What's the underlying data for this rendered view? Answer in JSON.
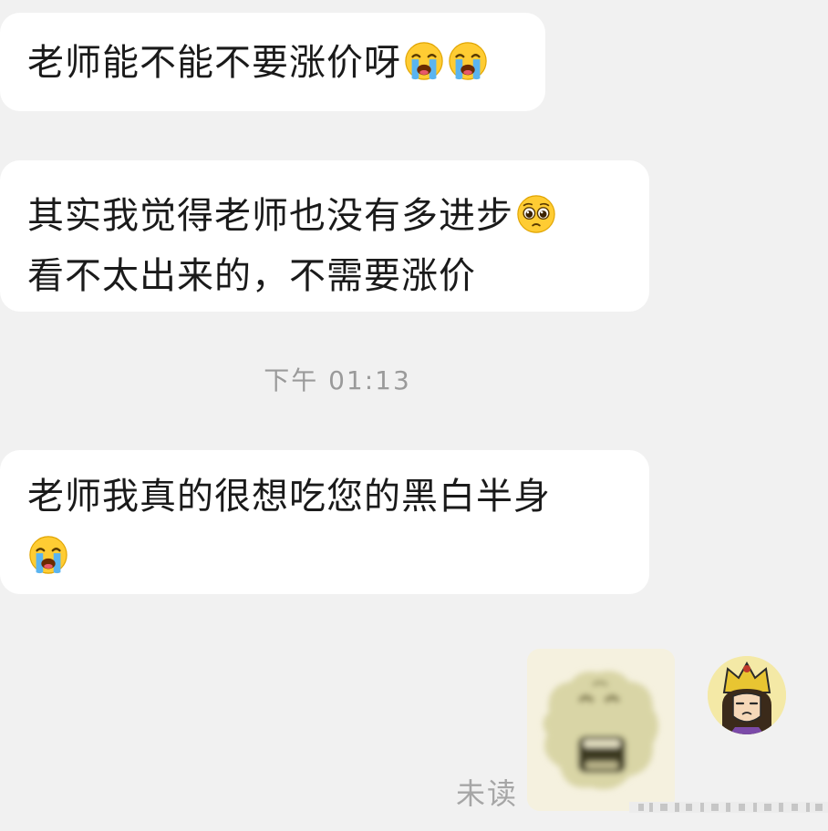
{
  "messages": [
    {
      "lines": [
        "老师能不能不要涨价呀"
      ],
      "trailing_emojis": [
        "crying-face",
        "crying-face"
      ]
    },
    {
      "lines": [
        "其实我觉得老师也没有多进步",
        "看不太出来的，不需要涨价"
      ],
      "line1_emoji": "pleading-face"
    },
    {
      "lines": [
        "老师我真的很想吃您的黑白半身"
      ],
      "trailing_emoji": "crying-face"
    }
  ],
  "timestamp": "下午 01:13",
  "read_status": "未读",
  "colors": {
    "background": "#f1f1f1",
    "bubble": "#ffffff",
    "text": "#1a1a1a",
    "timestamp": "#9a9a9a",
    "emoji_yellow": "#ffcc33",
    "tears": "#5ab4f0"
  },
  "icons": [
    "crying-face-emoji",
    "pleading-face-emoji",
    "sticker-image",
    "user-avatar"
  ]
}
